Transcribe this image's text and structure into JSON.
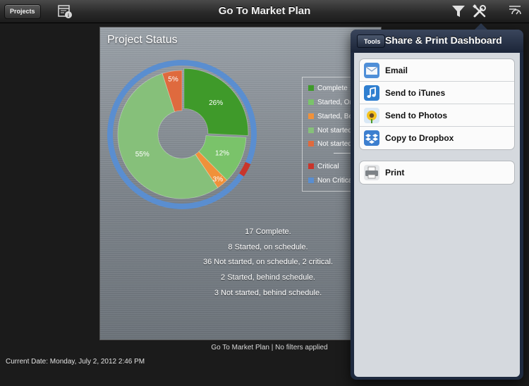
{
  "app": {
    "title": "Go To Market Plan",
    "projects_button": "Projects"
  },
  "toolbar": {
    "left_icon": "calendar-info-icon",
    "right_icons": [
      "filter-icon",
      "tools-icon",
      "dashboard-refresh-icon"
    ]
  },
  "dashboard": {
    "title": "Project Status",
    "chart_data": {
      "type": "pie",
      "variant": "donut-with-outer-ring",
      "slices": [
        {
          "label": "Complete",
          "value": 26,
          "display": "26%",
          "color": "#3f9a2a"
        },
        {
          "label": "Started, On schedule",
          "value": 12,
          "display": "12%",
          "color": "#7ac36a"
        },
        {
          "label": "Started, Behind schedule",
          "value": 3,
          "display": "3%",
          "color": "#f0913a"
        },
        {
          "label": "Not started, on schedule",
          "value": 55,
          "display": "55%",
          "color": "#86c07a"
        },
        {
          "label": "Not started, behind schedule",
          "value": 5,
          "display": "5%",
          "color": "#df6a3e"
        }
      ],
      "outer_ring": [
        {
          "label": "Critical",
          "value": 3,
          "color": "#c9352b"
        },
        {
          "label": "Non Critical",
          "value": 97,
          "color": "#5a8ed0"
        }
      ],
      "legend_placement": "right"
    },
    "legend": [
      {
        "label": "Complete",
        "color": "#3f9a2a"
      },
      {
        "label": "Started, On schedule",
        "color": "#7ac36a"
      },
      {
        "label": "Started, Behind schedule",
        "color": "#f0913a"
      },
      {
        "label": "Not started, on schedule",
        "color": "#86c07a"
      },
      {
        "label": "Not started, behind schedule",
        "color": "#df6a3e"
      },
      {
        "label": "Critical",
        "color": "#c9352b"
      },
      {
        "label": "Non Critical",
        "color": "#5a8ed0"
      }
    ],
    "summary": [
      "17 Complete.",
      "8 Started, on schedule.",
      "36 Not started, on schedule, 2 critical.",
      "2 Started, behind schedule.",
      "3 Not started, behind schedule."
    ]
  },
  "footer": {
    "caption": "Go To Market Plan | No filters applied",
    "current_date": "Current Date: Monday, July 2, 2012 2:46 PM"
  },
  "popover": {
    "back_button": "Tools",
    "title": "Share & Print Dashboard",
    "share_items": [
      {
        "label": "Email",
        "icon": "mail-icon"
      },
      {
        "label": "Send to iTunes",
        "icon": "itunes-icon"
      },
      {
        "label": "Send to Photos",
        "icon": "photos-icon"
      },
      {
        "label": "Copy to Dropbox",
        "icon": "dropbox-icon"
      }
    ],
    "print_item": {
      "label": "Print",
      "icon": "printer-icon"
    }
  }
}
